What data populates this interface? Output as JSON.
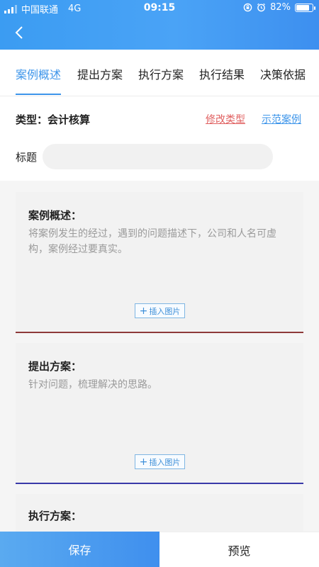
{
  "status_bar": {
    "carrier": "中国联通",
    "network": "4G",
    "time": "09:15",
    "battery": "82%",
    "battery_level": 0.82
  },
  "tabs": [
    {
      "label": "案例概述",
      "active": true
    },
    {
      "label": "提出方案",
      "active": false
    },
    {
      "label": "执行方案",
      "active": false
    },
    {
      "label": "执行结果",
      "active": false
    },
    {
      "label": "决策依据",
      "active": false
    }
  ],
  "type_row": {
    "label": "类型：",
    "value": "会计核算",
    "edit_link": "修改类型",
    "example_link": "示范案例"
  },
  "title_field": {
    "label": "标题",
    "value": "",
    "placeholder": ""
  },
  "cards": [
    {
      "title": "案例概述：",
      "hint": "将案例发生的经过，遇到的问题描述下，公司和人名可虚构，案例经过要真实。",
      "insert_label": "插入图片"
    },
    {
      "title": "提出方案：",
      "hint": "针对问题，梳理解决的思路。",
      "insert_label": "插入图片"
    },
    {
      "title": "执行方案：",
      "hint": ""
    }
  ],
  "bottom": {
    "save_label": "保存",
    "preview_label": "预览"
  },
  "colors": {
    "accent": "#3d95ea",
    "edit_link": "#e06060",
    "card1_border": "#8e3a3a",
    "card2_border": "#3a3aa8"
  },
  "icons": {
    "back": "chevron-left-icon",
    "signal": "signal-icon",
    "lock_rotation": "rotation-lock-icon",
    "alarm": "alarm-icon",
    "battery": "battery-icon",
    "insert": "plus-icon"
  }
}
